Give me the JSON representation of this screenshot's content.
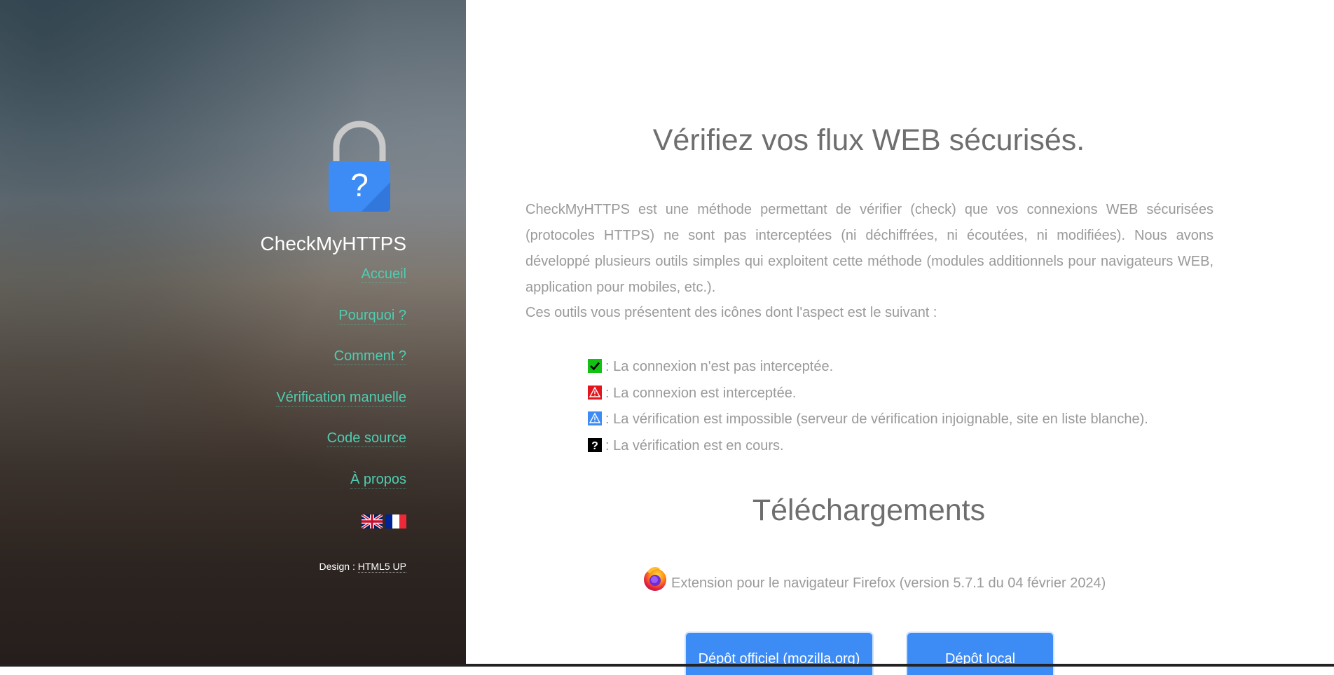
{
  "sidebar": {
    "site_title": "CheckMyHTTPS",
    "logo_icon": "padlock-question-icon",
    "nav": [
      {
        "label": "Accueil"
      },
      {
        "label": "Pourquoi ?"
      },
      {
        "label": "Comment ?"
      },
      {
        "label": "Vérification manuelle"
      },
      {
        "label": "Code source"
      },
      {
        "label": "À propos"
      }
    ],
    "languages": [
      "english-flag-icon",
      "french-flag-icon"
    ],
    "credit_prefix": "Design : ",
    "credit_link": "HTML5 UP"
  },
  "main": {
    "heading": "Vérifiez vos flux WEB sécurisés.",
    "intro": "CheckMyHTTPS est une méthode permettant de vérifier (check) que vos connexions WEB sécurisées (protocoles HTTPS) ne sont pas interceptées (ni déchiffrées, ni écoutées, ni modifiées). Nous avons développé plusieurs outils simples qui exploitent cette méthode (modules additionnels pour navigateurs WEB, application pour mobiles, etc.).",
    "intro2": "Ces outils vous présentent des icônes dont l'aspect est le suivant :",
    "legend": [
      {
        "icon": "green-check-icon",
        "text": ": La connexion n'est pas interceptée."
      },
      {
        "icon": "red-warning-icon",
        "text": ": La connexion est interceptée."
      },
      {
        "icon": "blue-warning-icon",
        "text": ": La vérification est impossible (serveur de vérification injoignable, site en liste blanche)."
      },
      {
        "icon": "black-question-icon",
        "text": ": La vérification est en cours."
      }
    ],
    "downloads_heading": "Téléchargements",
    "firefox_icon": "firefox-icon",
    "extension_text": "Extension pour le navigateur Firefox (version 5.7.1 du 04 février 2024)",
    "btn_official": "Dépôt officiel (mozilla.org)",
    "btn_local": "Dépôt local"
  },
  "colors": {
    "accent": "#4ecdb1",
    "button": "#3d8bf5",
    "text_muted": "#9a9a9a",
    "heading": "#6e6e6e"
  }
}
